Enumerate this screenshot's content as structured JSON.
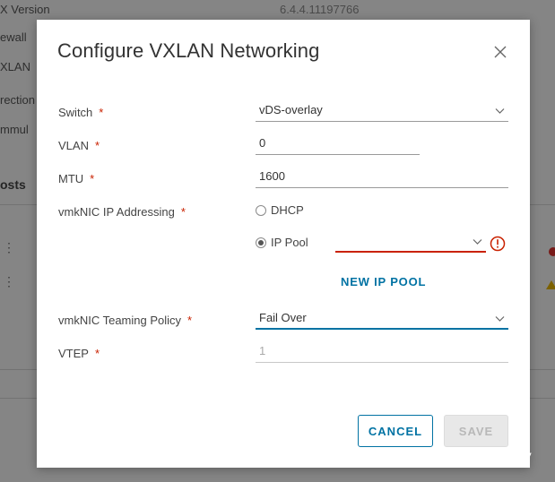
{
  "background": {
    "rows": [
      "X Version",
      "ewall",
      "XLAN",
      "rection",
      "mmul"
    ],
    "version_value": "6.4.4.11197766",
    "section_heading": "osts"
  },
  "dialog": {
    "title": "Configure VXLAN Networking",
    "close_icon": "close-icon",
    "required_mark": "*",
    "fields": {
      "switch": {
        "label": "Switch",
        "value": "vDS-overlay"
      },
      "vlan": {
        "label": "VLAN",
        "value": "0"
      },
      "mtu": {
        "label": "MTU",
        "value": "1600"
      },
      "vmknic_ip": {
        "label": "vmkNIC IP Addressing",
        "options": [
          "DHCP",
          "IP Pool"
        ],
        "selected": "IP Pool",
        "ip_pool_value": ""
      },
      "teaming": {
        "label": "vmkNIC Teaming Policy",
        "value": "Fail Over"
      },
      "vtep": {
        "label": "VTEP",
        "value": "1"
      }
    },
    "new_ip_pool_label": "NEW IP POOL",
    "cancel_label": "CANCEL",
    "save_label": "SAVE"
  },
  "watermark": {
    "text": "微信号: JUJUXV"
  },
  "colors": {
    "accent": "#0072a3",
    "error": "#c92100",
    "required": "#c92100"
  }
}
